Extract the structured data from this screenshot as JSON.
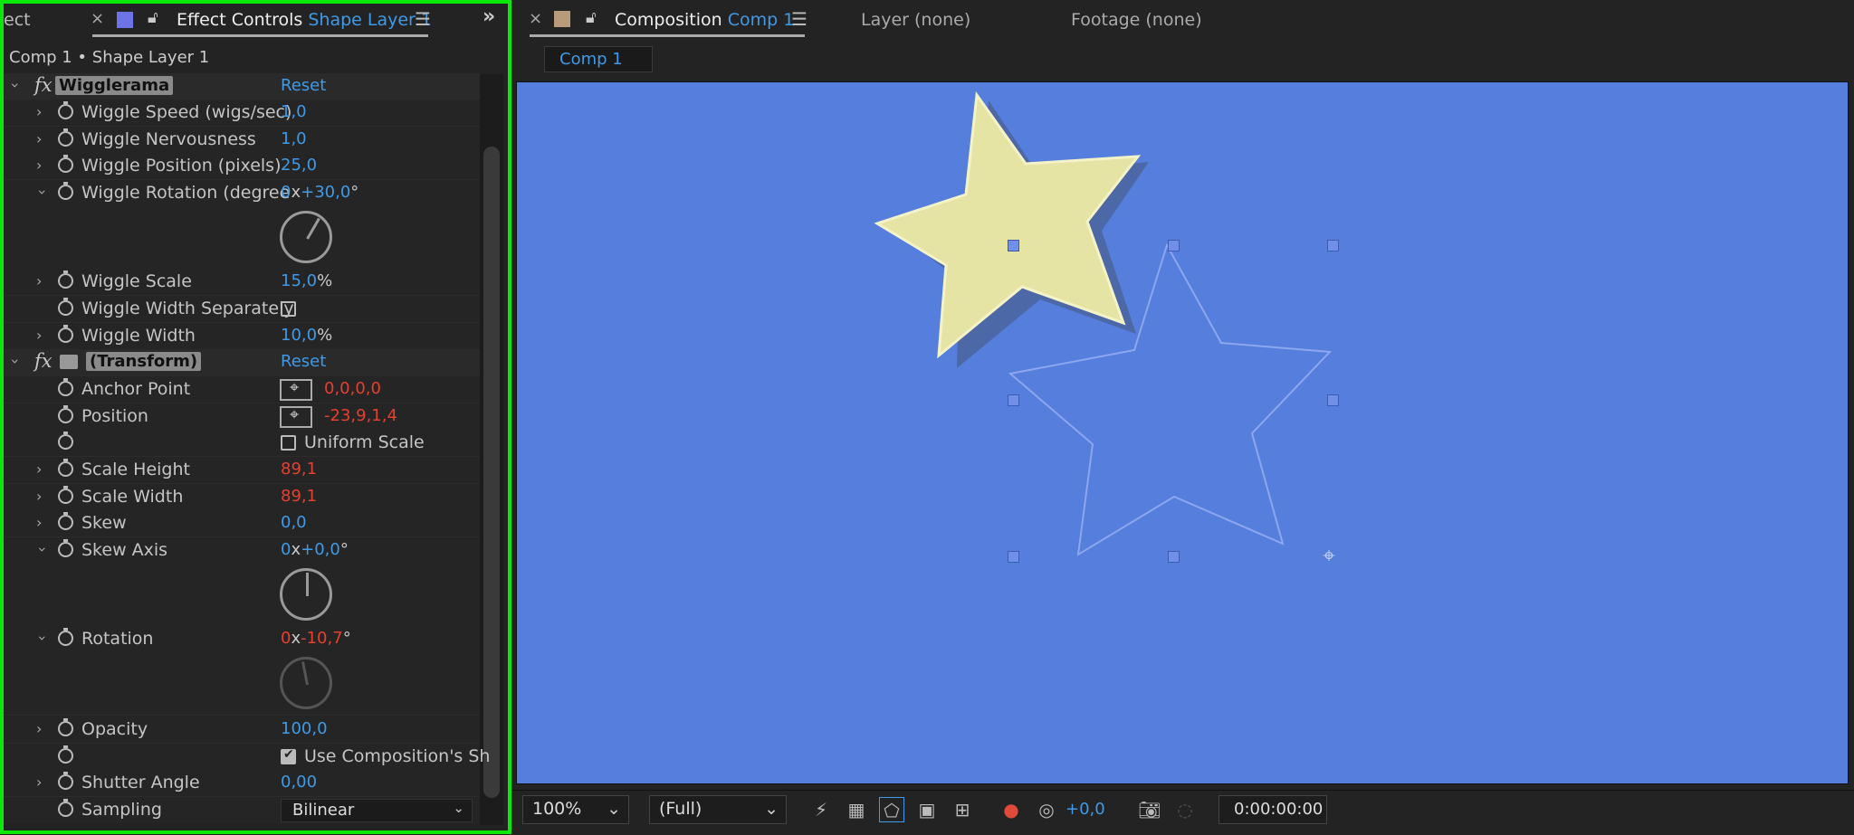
{
  "left_panel": {
    "partial_tab": "ect",
    "tab_close": "×",
    "tab_title": "Effect Controls",
    "tab_layer": "Shape Layer 1",
    "menu_icon": "hamburger-menu-icon",
    "overflow_icon": "double-chevron-right-icon",
    "breadcrumb": "Comp 1 • Shape Layer 1",
    "effects": {
      "wigglerama": {
        "fx": "fx",
        "name": "Wigglerama",
        "reset": "Reset"
      },
      "transform": {
        "fx": "fx",
        "name": "(Transform)",
        "reset": "Reset"
      }
    },
    "props": {
      "wiggle_speed": {
        "name": "Wiggle Speed (wigs/sec)",
        "value": "1,0"
      },
      "wiggle_nervousness": {
        "name": "Wiggle Nervousness",
        "value": "1,0"
      },
      "wiggle_position": {
        "name": "Wiggle Position (pixels)",
        "value": "25,0"
      },
      "wiggle_rotation": {
        "name": "Wiggle Rotation (degree",
        "rev": "0",
        "x": "x",
        "deg": "+30,0",
        "unit": "°"
      },
      "wiggle_scale": {
        "name": "Wiggle Scale",
        "value": "15,0",
        "unit": "%"
      },
      "wiggle_width_sep": {
        "name": "Wiggle Width Separately",
        "checked": false
      },
      "wiggle_width": {
        "name": "Wiggle Width",
        "value": "10,0",
        "unit": "%"
      },
      "anchor_point": {
        "name": "Anchor Point",
        "value": "0,0,0,0"
      },
      "position": {
        "name": "Position",
        "value": "-23,9,1,4"
      },
      "uniform_scale": {
        "label": "Uniform Scale",
        "checked": false
      },
      "scale_height": {
        "name": "Scale Height",
        "value": "89,1"
      },
      "scale_width": {
        "name": "Scale Width",
        "value": "89,1"
      },
      "skew": {
        "name": "Skew",
        "value": "0,0"
      },
      "skew_axis": {
        "name": "Skew Axis",
        "rev": "0",
        "x": "x",
        "deg": "+0,0",
        "unit": "°"
      },
      "rotation": {
        "name": "Rotation",
        "rev": "0",
        "x": "x",
        "deg": "-10,7",
        "unit": "°"
      },
      "opacity": {
        "name": "Opacity",
        "value": "100,0"
      },
      "use_comp_shutter": {
        "label": "Use Composition's Sh",
        "checked": true
      },
      "shutter_angle": {
        "name": "Shutter Angle",
        "value": "0,00"
      },
      "sampling": {
        "name": "Sampling",
        "value": "Bilinear"
      }
    }
  },
  "right_panel": {
    "tab_close": "×",
    "tab_title": "Composition",
    "tab_comp": "Comp 1",
    "layer_tab": "Layer (none)",
    "footage_tab": "Footage (none)",
    "subtab": "Comp 1",
    "bottom": {
      "zoom": "100%",
      "resolution": "(Full)",
      "exposure": "+0,0",
      "timecode": "0:00:00:00"
    }
  },
  "colors": {
    "accent_blue": "#3f9ae8",
    "value_red": "#e5402f",
    "comp_bg": "#557edd",
    "panel_highlight": "#0be90b"
  }
}
